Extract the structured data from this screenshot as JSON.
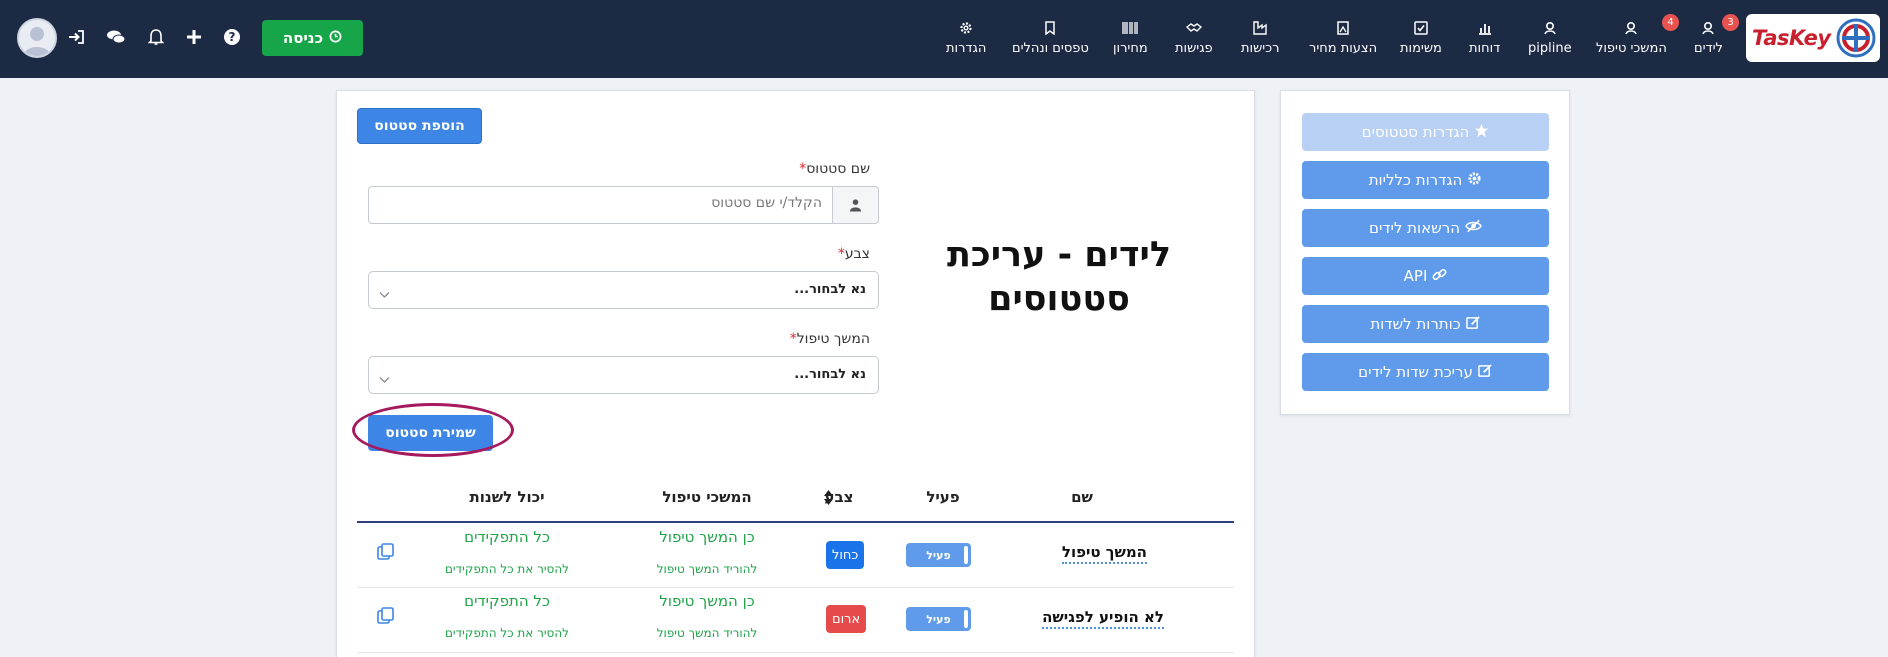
{
  "brand": {
    "logo_text": "TasKey"
  },
  "nav": {
    "items": [
      {
        "label": "לידים",
        "icon": "leads-icon",
        "badge": "3"
      },
      {
        "label": "המשכי טיפול",
        "icon": "followup-icon",
        "badge": "4"
      },
      {
        "label": "pipline",
        "icon": "pipeline-icon"
      },
      {
        "label": "דוחות",
        "icon": "reports-icon"
      },
      {
        "label": "משימות",
        "icon": "tasks-icon"
      },
      {
        "label": "הצעות מחיר",
        "icon": "quotes-icon"
      },
      {
        "label": "רכישות",
        "icon": "purchases-icon"
      },
      {
        "label": "פגישות",
        "icon": "meetings-icon"
      },
      {
        "label": "מחירון",
        "icon": "pricelist-icon"
      },
      {
        "label": "טפסים ונהלים",
        "icon": "forms-icon"
      },
      {
        "label": "הגדרות",
        "icon": "settings-icon"
      }
    ],
    "enter_label": "כניסה"
  },
  "sidebar": {
    "buttons": [
      {
        "label": "הגדרות סטטוסים",
        "icon": "star-icon",
        "disabled": true
      },
      {
        "label": "הגדרות כלליות",
        "icon": "gear-icon"
      },
      {
        "label": "הרשאות לידים",
        "icon": "eye-slash-icon"
      },
      {
        "label": "API",
        "icon": "link-icon"
      },
      {
        "label": "כותרות לשדות",
        "icon": "edit-icon"
      },
      {
        "label": "עריכת שדות לידים",
        "icon": "edit-icon"
      }
    ]
  },
  "main": {
    "add_status_label": "הוספת סטטוס",
    "title_line1": "לידים - עריכת",
    "title_line2": "סטטוסים",
    "form": {
      "status_name_label": "שם סטטוס",
      "status_name_placeholder": "הקלד/י שם סטטוס",
      "color_label": "צבע",
      "color_value": "נא לבחור...",
      "followup_label": "המשך טיפול",
      "followup_value": "נא לבחור...",
      "required_mark": "*",
      "save_label": "שמירת סטטוס"
    },
    "table": {
      "headers": {
        "name": "שם",
        "active": "פעיל",
        "color": "צבע",
        "followup": "המשכי טיפול",
        "can_change": "יכול לשנות"
      },
      "rows": [
        {
          "name": "המשך טיפול",
          "active": "פעיל",
          "color_label": "כחול",
          "color_hex": "#1a73e8",
          "followup_main": "כן המשך טיפול",
          "followup_sub": "להוריד המשך טיפול",
          "can_change_main": "כל התפקידים",
          "can_change_sub": "להסיר את כל התפקידים"
        },
        {
          "name": "לא הופיע לפגישה",
          "active": "פעיל",
          "color_label": "ארום",
          "color_hex": "#e74a4a",
          "followup_main": "כן המשך טיפול",
          "followup_sub": "להוריד המשך טיפול",
          "can_change_main": "כל התפקידים",
          "can_change_sub": "להסיר את כל התפקידים"
        }
      ]
    }
  },
  "colors": {
    "nav_bg": "#1d2a44",
    "primary": "#3d86e6",
    "sidebar_btn": "#5f9bea",
    "green": "#17a54a",
    "badge": "#e8534f",
    "highlight": "#a6195d"
  }
}
